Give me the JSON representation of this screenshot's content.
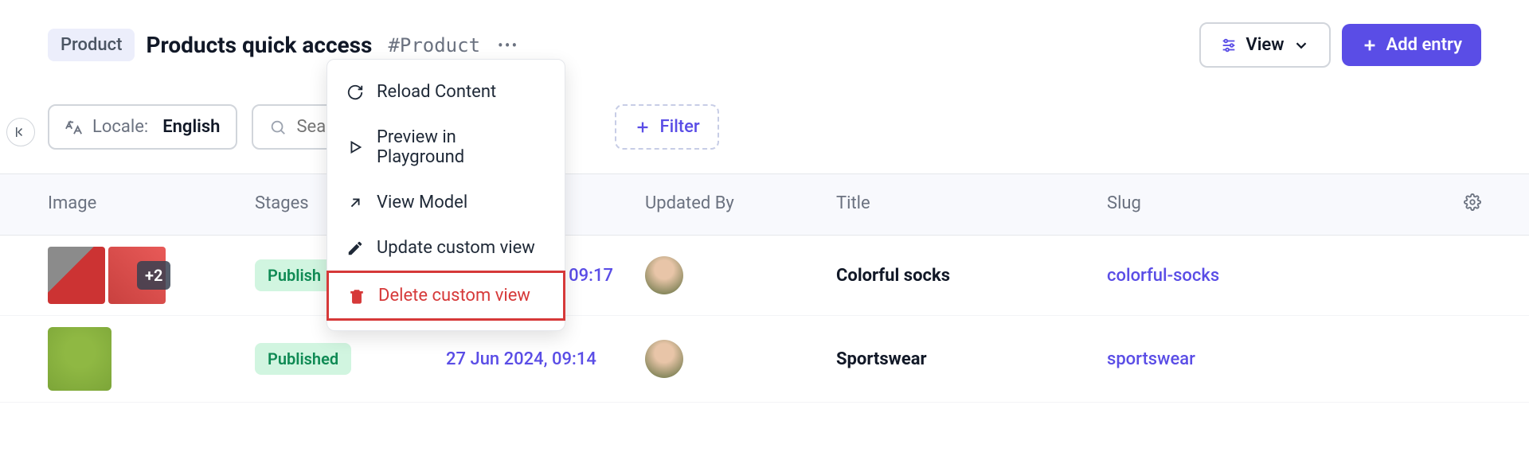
{
  "header": {
    "badge": "Product",
    "title": "Products quick access",
    "tag": "#Product",
    "view_label": "View",
    "add_label": "Add entry"
  },
  "toolbar": {
    "locale_label": "Locale:",
    "locale_value": "English",
    "search_placeholder": "Search",
    "filter_label": "Filter"
  },
  "columns": {
    "image": "Image",
    "stages": "Stages",
    "updated_by": "Updated By",
    "title": "Title",
    "slug": "Slug"
  },
  "dropdown": {
    "reload": "Reload Content",
    "preview": "Preview in Playground",
    "view_model": "View Model",
    "update": "Update custom view",
    "delete": "Delete custom view"
  },
  "rows": [
    {
      "more_count": "+2",
      "stage": "Published",
      "stage_visible": "Publish",
      "updated": "09:17",
      "title": "Colorful socks",
      "slug": "colorful-socks"
    },
    {
      "stage": "Published",
      "updated": "27 Jun 2024, 09:14",
      "title": "Sportswear",
      "slug": "sportswear"
    }
  ]
}
